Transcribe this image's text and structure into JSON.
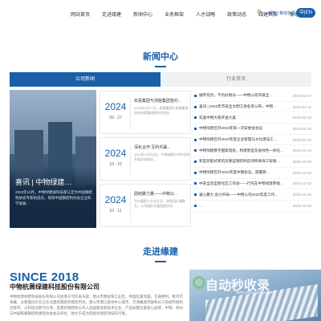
{
  "nav": {
    "items": [
      "网站首页",
      "走进缘建",
      "新闻中心",
      "业务框架",
      "人才战略",
      "政策动态",
      "绿建风采",
      "联系我们"
    ],
    "search_icon": "search-icon",
    "link": "邮箱 | 移动协同",
    "lang": "中|EN"
  },
  "news": {
    "title": "新闻中心",
    "tabs": [
      "公司新闻",
      "行业资讯"
    ],
    "featured": {
      "title": "喜讯 | 中物绿建…",
      "desc": "2023年10月，中物绿建被科技部认定为中国钢结构协会专家组成员，取得中国钢结构协会企业科学发展…"
    },
    "cards": [
      {
        "year": "2024",
        "date": "09 - 27",
        "title": "双喜集团与浙能集团签约…",
        "desc": "2024年9月27日，双喜集团与浙能集团在杭州签署战略合作协议…"
      },
      {
        "year": "2024",
        "date": "10 - 15",
        "title": "深化合作 互利共赢…",
        "desc": "2024年10月15日，中物绿建与合作伙伴开展交流座谈…"
      },
      {
        "year": "2024",
        "date": "10 - 11",
        "title": "团结聚力量——中物公…",
        "desc": "为丰富职工文化生活，增强团队凝聚力，公司组织开展团建活动…"
      }
    ],
    "list": [
      {
        "title": "缅怀先烈，不负好春光——中物公司开展全…",
        "date": "2024-04-27"
      },
      {
        "title": "喜讯 | 2022年市安全文明工地名单公布，中物…",
        "date": "2023-02-11"
      },
      {
        "title": "双喜中物大家开送大喜",
        "date": "2023-03-13"
      },
      {
        "title": "中物绿建召开2023年第一次安委会会议",
        "date": "2023-02-15"
      },
      {
        "title": "中物绿建召开2023年度企业管理与文化建设工…",
        "date": "2023-02-02"
      },
      {
        "title": "中物绿建携手国家电投，构建新型先进绿色一体化…",
        "date": "2023-01-14"
      },
      {
        "title": "新型装配式建筑双重型钢装制造项目填海工程竣…",
        "date": "2022-12-29"
      },
      {
        "title": "中物绿建召开2022年度中期会议，部署要…",
        "date": "2022-12-02"
      },
      {
        "title": "中安全造型新社区工作会——行先在中物绿建参观…",
        "date": "2022-12-02"
      },
      {
        "title": "凝心聚力 奋力开局——中物公司2023年度工作…",
        "date": "2022-11-28"
      },
      {
        "title": "…",
        "date": "2022-11-28"
      }
    ]
  },
  "about": {
    "title": "走进缘建",
    "since": "SINCE 2018",
    "company": "中物杭萧绿建科技股份有限公司",
    "text": "中物杭萧绿建科技股份有限公司坐落于河北省东部，唐山市曹妃甸工业区，地理位置优越，交通便利。毗邻京津冀，主要面向华北与东北建筑钢结构建筑市场，唐山市港口基地中心城市，京津翼城市群和长三角城市群的连接带，以科技创新为引领，是建筑钢结构公司入选国家高新技术企业、产品质量信誉放心品牌，中物、杭州与中国铁路钢结构建筑协会会员单位，致力于成为装配式建筑领域先行者。",
    "watermark": "自动秒收录",
    "watermark_url": "www.zidongmiao.com"
  }
}
